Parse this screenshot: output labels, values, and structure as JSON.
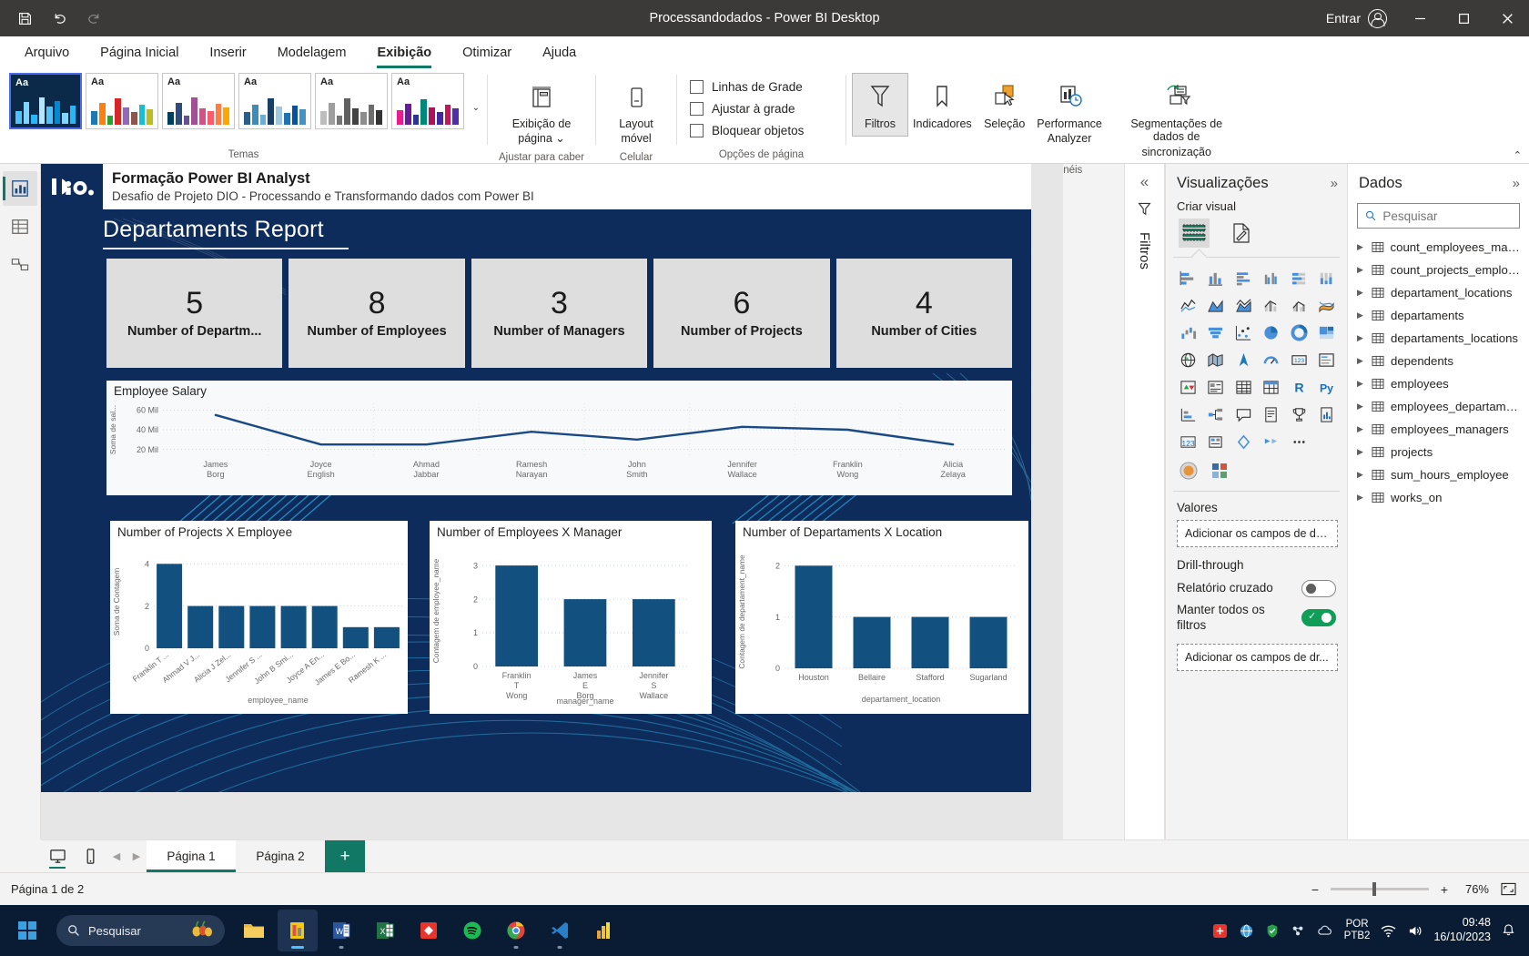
{
  "window": {
    "title": "Processandodados - Power BI Desktop",
    "save_icon": "save-icon",
    "undo_icon": "undo-icon",
    "redo_icon": "redo-icon",
    "signin_label": "Entrar",
    "minimize": "–",
    "maximize": "▢",
    "close": "✕"
  },
  "menu": {
    "items": [
      {
        "label": "Arquivo",
        "active": false
      },
      {
        "label": "Página Inicial",
        "active": false
      },
      {
        "label": "Inserir",
        "active": false
      },
      {
        "label": "Modelagem",
        "active": false
      },
      {
        "label": "Exibição",
        "active": true
      },
      {
        "label": "Otimizar",
        "active": false
      },
      {
        "label": "Ajuda",
        "active": false
      }
    ]
  },
  "ribbon": {
    "themes_group_label": "Temas",
    "theme_aa": "Aa",
    "fit_group_label": "Ajustar para caber",
    "page_view_label": "Exibição de\npágina ⌄",
    "page_view_line1": "Exibição de",
    "page_view_line2": "página ⌄",
    "mobile_group_label": "Celular",
    "mobile_line1": "Layout",
    "mobile_line2": "móvel",
    "page_options_label": "Opções de página",
    "checkboxes": [
      {
        "label": "Linhas de Grade",
        "checked": false
      },
      {
        "label": "Ajustar à grade",
        "checked": false
      },
      {
        "label": "Bloquear objetos",
        "checked": false
      }
    ],
    "panes_group_label": "Mostrar painéis",
    "panes": [
      {
        "label": "Filtros",
        "active": true
      },
      {
        "label": "Indicadores",
        "active": false
      },
      {
        "label": "Seleção",
        "active": false
      },
      {
        "label": "Performance\nAnalyzer",
        "line1": "Performance",
        "line2": "Analyzer",
        "active": false
      },
      {
        "label": "Segmentações de dados de sincronização",
        "line1": "Segmentações de dados de",
        "line2": "sincronização",
        "active": false
      }
    ],
    "collapse_icon": "chevron-up-icon"
  },
  "left_rail": {
    "items": [
      {
        "name": "report-view",
        "icon": "report-chart-icon",
        "selected": true
      },
      {
        "name": "table-view",
        "icon": "table-grid-icon",
        "selected": false
      },
      {
        "name": "model-view",
        "icon": "model-relationship-icon",
        "selected": false
      }
    ]
  },
  "report": {
    "header_title": "Formação Power BI Analyst",
    "header_subtitle": "Desafio de Projeto DIO - Processando e Transformando dados com Power BI",
    "logo_text": "dio.",
    "page_heading": "Departaments Report",
    "kpis": [
      {
        "value": "5",
        "label": "Number of Departm..."
      },
      {
        "value": "8",
        "label": "Number of Employees"
      },
      {
        "value": "3",
        "label": "Number of Managers"
      },
      {
        "value": "6",
        "label": "Number of Projects"
      },
      {
        "value": "4",
        "label": "Number of Cities"
      }
    ]
  },
  "chart_data": [
    {
      "type": "line",
      "title": "Employee Salary",
      "xlabel": "",
      "ylabel": "Soma de sal...",
      "categories": [
        "James Borg",
        "Joyce English",
        "Ahmad Jabbar",
        "Ramesh Narayan",
        "John Smith",
        "Jennifer Wallace",
        "Franklin Wong",
        "Alicia Zelaya"
      ],
      "values": [
        55000,
        25000,
        25000,
        38000,
        30000,
        43000,
        40000,
        25000
      ],
      "yticks": [
        "20 Mil",
        "40 Mil",
        "60 Mil"
      ],
      "ytickvalues": [
        20000,
        40000,
        60000
      ],
      "ylim": [
        15000,
        65000
      ],
      "grid": true,
      "legend": "none",
      "line_color": "#1a4a85"
    },
    {
      "type": "bar",
      "title": "Number of Projects X Employee",
      "xlabel": "employee_name",
      "ylabel": "Soma de Contagem",
      "categories": [
        "Franklin T ...",
        "Ahmad V J...",
        "Alicia J Zel...",
        "Jennifer S ...",
        "John B Smi...",
        "Joyce A En...",
        "James E Bo...",
        "Ramesh K ..."
      ],
      "values": [
        4,
        2,
        2,
        2,
        2,
        2,
        1,
        1
      ],
      "yticks": [
        "0",
        "2",
        "4"
      ],
      "ytickvalues": [
        0,
        2,
        4
      ],
      "ylim": [
        0,
        4.4
      ],
      "grid": true,
      "bar_color": "#12507f"
    },
    {
      "type": "bar",
      "title": "Number of Employees X Manager",
      "xlabel": "manager_name",
      "ylabel": "Contagem de employee_name",
      "categories": [
        "Franklin T Wong",
        "James E Borg",
        "Jennifer S Wallace"
      ],
      "values": [
        3,
        2,
        2
      ],
      "yticks": [
        "0",
        "1",
        "2",
        "3"
      ],
      "ytickvalues": [
        0,
        1,
        2,
        3
      ],
      "ylim": [
        0,
        3.3
      ],
      "grid": true,
      "bar_color": "#12507f"
    },
    {
      "type": "bar",
      "title": "Number of Departaments X Location",
      "xlabel": "departament_location",
      "ylabel": "Contagem de departament_name",
      "categories": [
        "Houston",
        "Bellaire",
        "Stafford",
        "Sugarland"
      ],
      "values": [
        2,
        1,
        1,
        1
      ],
      "yticks": [
        "0",
        "1",
        "2"
      ],
      "ytickvalues": [
        0,
        1,
        2
      ],
      "ylim": [
        0,
        2.2
      ],
      "grid": true,
      "bar_color": "#12507f"
    }
  ],
  "filters_rail": {
    "collapse_icon": "chevrons-left-icon",
    "filter_icon": "filter-funnel-icon",
    "label": "Filtros"
  },
  "viz_pane": {
    "title": "Visualizações",
    "expand_icon": "chevrons-right-icon",
    "create_visual_label": "Criar visual",
    "top_buttons": [
      {
        "name": "build-visual-icon",
        "selected": true
      },
      {
        "name": "format-visual-icon",
        "selected": false
      }
    ],
    "values_label": "Valores",
    "values_placeholder": "Adicionar os campos de da...",
    "drillthrough_label": "Drill-through",
    "cross_report_label": "Relatório cruzado",
    "cross_report_on": false,
    "keep_all_filters_label": "Manter todos os filtros",
    "keep_all_filters_on": true,
    "drill_placeholder": "Adicionar os campos de dr..."
  },
  "data_pane": {
    "title": "Dados",
    "expand_icon": "chevrons-right-icon",
    "search_placeholder": "Pesquisar",
    "search_value": "",
    "tables": [
      "count_employees_man...",
      "count_projects_employ...",
      "departament_locations",
      "departaments",
      "departaments_locations",
      "dependents",
      "employees",
      "employees_departame...",
      "employees_managers",
      "projects",
      "sum_hours_employee",
      "works_on"
    ]
  },
  "page_tabs": {
    "desktop_icon": "desktop-layout-icon",
    "phone_icon": "phone-layout-icon",
    "prev_icon": "chevron-left-icon",
    "next_icon": "chevron-right-icon",
    "tabs": [
      {
        "label": "Página 1",
        "selected": true
      },
      {
        "label": "Página 2",
        "selected": false
      }
    ],
    "add_label": "+"
  },
  "status_bar": {
    "page_indicator": "Página 1 de 2",
    "zoom_minus": "−",
    "zoom_plus": "+",
    "zoom_value": "76%",
    "fit_icon": "fit-to-page-icon"
  },
  "taskbar": {
    "start_icon": "windows-start-icon",
    "search_placeholder": "Pesquisar",
    "search_icon": "search-icon",
    "apps": [
      {
        "name": "file-explorer-icon",
        "active": false,
        "running": false
      },
      {
        "name": "power-bi-desktop-icon",
        "active": true,
        "running": true
      },
      {
        "name": "word-icon",
        "active": false,
        "running": true
      },
      {
        "name": "excel-icon",
        "active": false,
        "running": false
      },
      {
        "name": "app-red-diamond-icon",
        "active": false,
        "running": false
      },
      {
        "name": "spotify-icon",
        "active": false,
        "running": false
      },
      {
        "name": "chrome-icon",
        "active": false,
        "running": true
      },
      {
        "name": "vscode-icon",
        "active": false,
        "running": true
      },
      {
        "name": "power-bi-service-icon",
        "active": false,
        "running": false
      }
    ],
    "lang_line1": "POR",
    "lang_line2": "PTB2",
    "clock_time": "09:48",
    "clock_date": "16/10/2023",
    "tray_icons": [
      "network-icon",
      "volume-icon",
      "notification-icon"
    ]
  }
}
